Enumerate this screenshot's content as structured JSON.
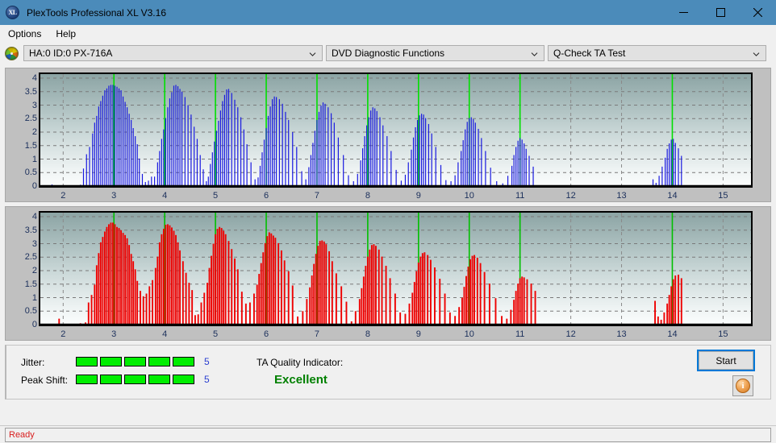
{
  "window": {
    "title": "PlexTools Professional XL V3.16",
    "icon": "xl-logo-icon",
    "minimize_label": "—",
    "maximize_label": "□",
    "close_label": "✕"
  },
  "menu": {
    "items": [
      {
        "label": "Options"
      },
      {
        "label": "Help"
      }
    ]
  },
  "selectors": {
    "drive_icon": "disc-icon",
    "drive": {
      "value": "HA:0 ID:0  PX-716A"
    },
    "function_group": {
      "value": "DVD Diagnostic Functions"
    },
    "test": {
      "value": "Q-Check TA Test"
    }
  },
  "bottom": {
    "jitter_label": "Jitter:",
    "jitter_value": "5",
    "jitter_bars": 5,
    "peak_shift_label": "Peak Shift:",
    "peak_shift_value": "5",
    "peak_shift_bars": 5,
    "ta_quality_label": "TA Quality Indicator:",
    "ta_quality_value": "Excellent",
    "ta_quality_color": "#008000",
    "bar_color": "#00ee00",
    "start_label": "Start",
    "info_icon": "info-icon"
  },
  "statusbar": {
    "text": "Ready",
    "color": "#d81e1e"
  },
  "chart_data": [
    {
      "id": "jitter-chart",
      "type": "bar",
      "title": "",
      "xlabel": "",
      "ylabel": "",
      "series_color": "#1a1ae0",
      "marker_color": "#00e000",
      "grid": true,
      "xlim": [
        1.55,
        15.55
      ],
      "ylim": [
        0,
        4.15
      ],
      "xticks": [
        2,
        3,
        4,
        5,
        6,
        7,
        8,
        9,
        10,
        11,
        12,
        13,
        14,
        15
      ],
      "yticks": [
        0,
        0.5,
        1,
        1.5,
        2,
        2.5,
        3,
        3.5,
        4
      ],
      "ytick_labels": [
        "0",
        "0.5",
        "1",
        "1.5",
        "2",
        "2.5",
        "3",
        "3.5",
        "4"
      ],
      "markers": [
        3,
        4,
        5,
        6,
        7,
        8,
        9,
        10,
        11,
        14
      ],
      "bar_width": 0.018,
      "x": [
        1.78,
        1.92,
        2.06,
        2.2,
        2.34,
        2.4,
        2.46,
        2.52,
        2.58,
        2.62,
        2.66,
        2.7,
        2.74,
        2.78,
        2.82,
        2.86,
        2.9,
        2.94,
        2.98,
        3.02,
        3.06,
        3.1,
        3.14,
        3.18,
        3.22,
        3.26,
        3.3,
        3.34,
        3.38,
        3.42,
        3.46,
        3.5,
        3.56,
        3.62,
        3.68,
        3.74,
        3.8,
        3.86,
        3.9,
        3.94,
        3.98,
        4.02,
        4.06,
        4.1,
        4.14,
        4.18,
        4.22,
        4.26,
        4.3,
        4.34,
        4.4,
        4.46,
        4.52,
        4.58,
        4.64,
        4.7,
        4.76,
        4.82,
        4.86,
        4.9,
        4.94,
        4.98,
        5.02,
        5.06,
        5.1,
        5.14,
        5.18,
        5.22,
        5.26,
        5.32,
        5.38,
        5.44,
        5.5,
        5.56,
        5.62,
        5.7,
        5.78,
        5.84,
        5.88,
        5.92,
        5.96,
        6.0,
        6.04,
        6.08,
        6.12,
        6.16,
        6.2,
        6.26,
        6.32,
        6.38,
        6.44,
        6.52,
        6.6,
        6.7,
        6.78,
        6.84,
        6.88,
        6.92,
        6.96,
        7.0,
        7.04,
        7.08,
        7.12,
        7.16,
        7.22,
        7.28,
        7.34,
        7.42,
        7.52,
        7.62,
        7.72,
        7.8,
        7.86,
        7.9,
        7.94,
        7.98,
        8.02,
        8.06,
        8.1,
        8.14,
        8.18,
        8.24,
        8.3,
        8.38,
        8.46,
        8.56,
        8.66,
        8.74,
        8.8,
        8.86,
        8.9,
        8.94,
        8.98,
        9.02,
        9.06,
        9.1,
        9.14,
        9.2,
        9.26,
        9.34,
        9.44,
        9.54,
        9.64,
        9.72,
        9.78,
        9.84,
        9.88,
        9.92,
        9.96,
        10.0,
        10.04,
        10.08,
        10.12,
        10.18,
        10.24,
        10.32,
        10.42,
        10.54,
        10.66,
        10.76,
        10.84,
        10.88,
        10.92,
        10.96,
        11.0,
        11.04,
        11.08,
        11.12,
        11.18,
        11.26,
        13.62,
        13.68,
        13.74,
        13.8,
        13.86,
        13.9,
        13.94,
        13.98,
        14.02,
        14.06,
        14.12,
        14.18
      ],
      "values": [
        0.06,
        0.03,
        0.02,
        0.02,
        0.05,
        0.65,
        1.18,
        1.45,
        1.95,
        2.35,
        2.6,
        2.95,
        3.15,
        3.35,
        3.55,
        3.62,
        3.72,
        3.75,
        3.75,
        3.72,
        3.68,
        3.62,
        3.55,
        3.32,
        3.12,
        2.92,
        2.68,
        2.45,
        2.15,
        1.85,
        1.55,
        1.02,
        0.45,
        0.15,
        0.2,
        0.35,
        0.35,
        0.88,
        1.3,
        1.75,
        2.1,
        2.52,
        2.92,
        3.25,
        3.48,
        3.72,
        3.75,
        3.7,
        3.6,
        3.5,
        3.3,
        3.0,
        2.65,
        2.2,
        1.75,
        1.15,
        0.62,
        0.18,
        0.35,
        0.82,
        1.25,
        1.65,
        2.05,
        2.42,
        2.8,
        3.15,
        3.38,
        3.58,
        3.6,
        3.45,
        3.2,
        2.92,
        2.55,
        2.1,
        1.55,
        0.88,
        0.25,
        0.32,
        0.75,
        1.25,
        1.72,
        2.15,
        2.6,
        2.95,
        3.22,
        3.32,
        3.3,
        3.22,
        3.05,
        2.75,
        2.45,
        2.0,
        1.45,
        0.55,
        0.25,
        0.7,
        1.15,
        1.6,
        2.05,
        2.45,
        2.75,
        2.98,
        3.1,
        3.05,
        2.92,
        2.7,
        2.35,
        1.8,
        1.15,
        0.4,
        0.18,
        0.45,
        0.95,
        1.4,
        1.85,
        2.25,
        2.55,
        2.8,
        2.92,
        2.88,
        2.78,
        2.55,
        2.25,
        1.85,
        1.3,
        0.6,
        0.2,
        0.42,
        0.88,
        1.35,
        1.8,
        2.18,
        2.45,
        2.62,
        2.68,
        2.65,
        2.52,
        2.3,
        1.95,
        1.45,
        0.78,
        0.22,
        0.18,
        0.4,
        0.88,
        1.3,
        1.7,
        2.1,
        2.38,
        2.52,
        2.55,
        2.48,
        2.35,
        2.12,
        1.78,
        1.3,
        0.68,
        0.18,
        0.1,
        0.38,
        0.75,
        1.15,
        1.45,
        1.68,
        1.78,
        1.72,
        1.58,
        1.38,
        1.12,
        0.72,
        0.25,
        0.12,
        0.38,
        0.72,
        1.05,
        1.38,
        1.58,
        1.72,
        1.75,
        1.6,
        1.4,
        1.12,
        0.78
      ]
    },
    {
      "id": "peak-shift-chart",
      "type": "bar",
      "title": "",
      "xlabel": "",
      "ylabel": "",
      "series_color": "#ee0000",
      "marker_color": "#00c000",
      "grid": true,
      "xlim": [
        1.55,
        15.55
      ],
      "ylim": [
        0,
        4.15
      ],
      "xticks": [
        2,
        3,
        4,
        5,
        6,
        7,
        8,
        9,
        10,
        11,
        12,
        13,
        14,
        15
      ],
      "yticks": [
        0,
        0.5,
        1,
        1.5,
        2,
        2.5,
        3,
        3.5,
        4
      ],
      "ytick_labels": [
        "0",
        "0.5",
        "1",
        "1.5",
        "2",
        "2.5",
        "3",
        "3.5",
        "4"
      ],
      "markers": [
        3,
        4,
        5,
        6,
        7,
        8,
        9,
        10,
        11,
        14
      ],
      "bar_width": 0.03,
      "x": [
        1.78,
        1.92,
        2.06,
        2.2,
        2.34,
        2.44,
        2.5,
        2.56,
        2.62,
        2.66,
        2.7,
        2.74,
        2.78,
        2.82,
        2.86,
        2.9,
        2.94,
        2.98,
        3.02,
        3.06,
        3.1,
        3.14,
        3.18,
        3.22,
        3.26,
        3.3,
        3.34,
        3.38,
        3.42,
        3.46,
        3.52,
        3.58,
        3.64,
        3.7,
        3.76,
        3.82,
        3.86,
        3.9,
        3.94,
        3.98,
        4.02,
        4.06,
        4.1,
        4.14,
        4.18,
        4.22,
        4.26,
        4.3,
        4.36,
        4.42,
        4.48,
        4.54,
        4.6,
        4.66,
        4.72,
        4.78,
        4.84,
        4.88,
        4.92,
        4.96,
        5.0,
        5.04,
        5.08,
        5.12,
        5.16,
        5.2,
        5.26,
        5.32,
        5.38,
        5.44,
        5.52,
        5.6,
        5.68,
        5.76,
        5.82,
        5.86,
        5.9,
        5.94,
        5.98,
        6.02,
        6.06,
        6.1,
        6.14,
        6.18,
        6.24,
        6.3,
        6.36,
        6.44,
        6.52,
        6.62,
        6.72,
        6.8,
        6.86,
        6.9,
        6.94,
        6.98,
        7.02,
        7.06,
        7.1,
        7.14,
        7.18,
        7.24,
        7.3,
        7.38,
        7.48,
        7.58,
        7.68,
        7.76,
        7.84,
        7.88,
        7.92,
        7.96,
        8.0,
        8.04,
        8.08,
        8.12,
        8.16,
        8.22,
        8.28,
        8.36,
        8.44,
        8.54,
        8.64,
        8.74,
        8.82,
        8.88,
        8.92,
        8.96,
        9.0,
        9.04,
        9.08,
        9.12,
        9.18,
        9.24,
        9.32,
        9.42,
        9.52,
        9.62,
        9.72,
        9.8,
        9.86,
        9.9,
        9.94,
        9.98,
        10.02,
        10.06,
        10.1,
        10.16,
        10.22,
        10.3,
        10.4,
        10.52,
        10.64,
        10.74,
        10.82,
        10.88,
        10.92,
        10.96,
        11.0,
        11.04,
        11.08,
        11.14,
        11.22,
        11.3,
        13.66,
        13.72,
        13.78,
        13.84,
        13.9,
        13.94,
        13.98,
        14.02,
        14.06,
        14.12,
        14.18
      ],
      "values": [
        0.03,
        0.22,
        0.02,
        0.02,
        0.05,
        0.08,
        0.82,
        1.1,
        1.48,
        2.2,
        2.65,
        3.05,
        3.25,
        3.45,
        3.62,
        3.72,
        3.78,
        3.78,
        3.72,
        3.62,
        3.58,
        3.5,
        3.4,
        3.32,
        3.2,
        2.95,
        2.62,
        2.35,
        2.05,
        1.62,
        1.25,
        1.05,
        1.15,
        1.42,
        1.65,
        2.1,
        2.52,
        3.05,
        3.35,
        3.55,
        3.7,
        3.72,
        3.68,
        3.6,
        3.48,
        3.32,
        3.05,
        2.75,
        2.35,
        1.92,
        1.55,
        1.28,
        0.35,
        0.38,
        0.82,
        1.18,
        1.55,
        2.1,
        2.55,
        3.0,
        3.35,
        3.55,
        3.62,
        3.58,
        3.48,
        3.35,
        3.1,
        2.8,
        2.45,
        2.05,
        1.22,
        0.78,
        0.82,
        1.15,
        1.48,
        1.88,
        2.28,
        2.68,
        3.02,
        3.28,
        3.42,
        3.38,
        3.3,
        3.22,
        3.02,
        2.75,
        2.38,
        1.98,
        1.45,
        0.3,
        0.5,
        0.95,
        1.38,
        1.82,
        2.25,
        2.62,
        2.92,
        3.1,
        3.12,
        3.08,
        2.98,
        2.72,
        2.35,
        1.9,
        1.42,
        0.85,
        0.12,
        0.5,
        0.95,
        1.35,
        1.78,
        2.18,
        2.52,
        2.78,
        2.95,
        2.98,
        2.92,
        2.78,
        2.52,
        2.18,
        1.72,
        1.15,
        0.45,
        0.4,
        0.78,
        1.18,
        1.58,
        1.98,
        2.3,
        2.52,
        2.65,
        2.68,
        2.58,
        2.4,
        2.12,
        1.7,
        1.15,
        0.45,
        0.32,
        0.65,
        1.0,
        1.4,
        1.8,
        2.15,
        2.42,
        2.55,
        2.58,
        2.48,
        2.28,
        1.95,
        1.52,
        0.98,
        0.32,
        0.22,
        0.55,
        0.92,
        1.25,
        1.52,
        1.72,
        1.78,
        1.75,
        1.68,
        1.52,
        1.25,
        0.88,
        0.3,
        0.18,
        0.45,
        0.78,
        1.1,
        1.42,
        1.68,
        1.82,
        1.85,
        1.72,
        1.52,
        1.25,
        0.85
      ]
    }
  ]
}
